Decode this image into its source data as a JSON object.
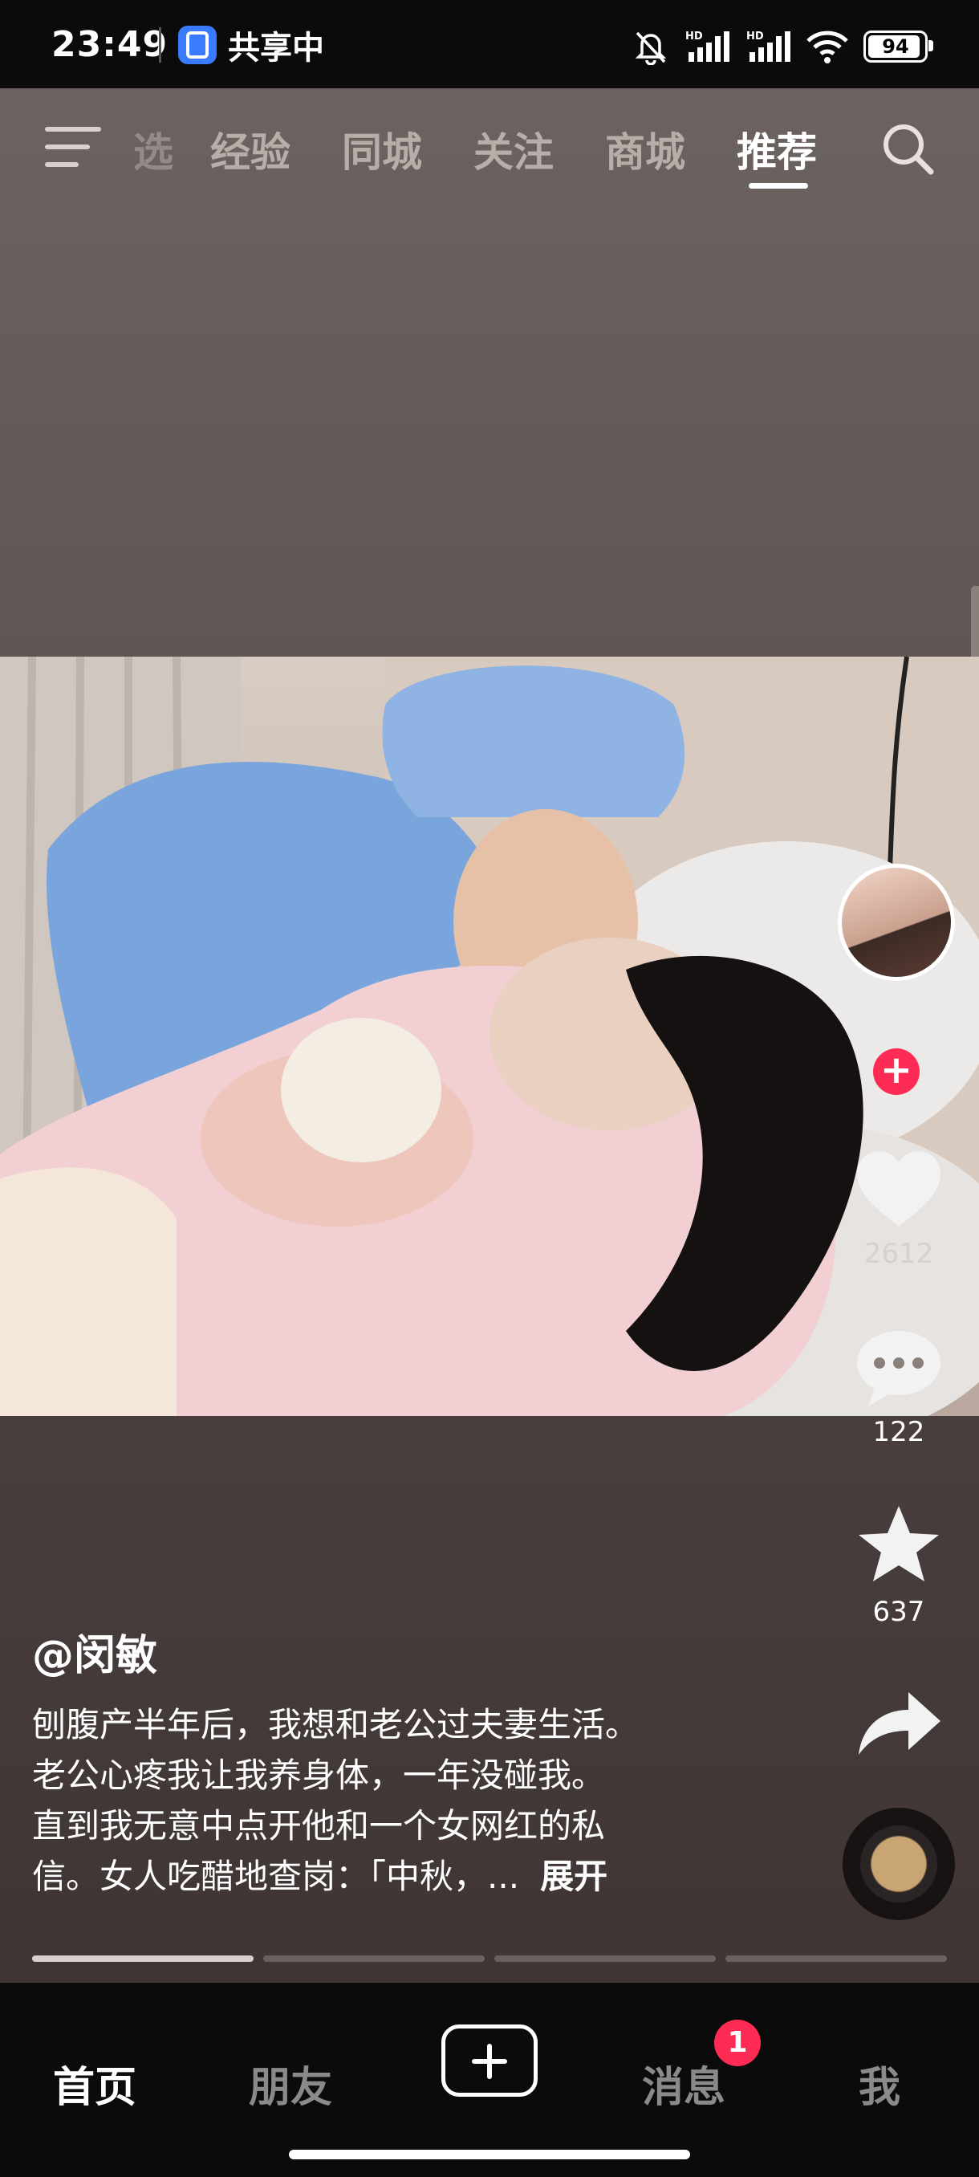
{
  "status_bar": {
    "time": "23:49",
    "share_label": "共享中",
    "battery": "94"
  },
  "top_nav": {
    "tabs": [
      {
        "label": "选"
      },
      {
        "label": "经验"
      },
      {
        "label": "同城"
      },
      {
        "label": "关注"
      },
      {
        "label": "商城"
      },
      {
        "label": "推荐"
      }
    ],
    "active_tab": "推荐"
  },
  "post": {
    "author": "@闵敏",
    "desc_lines": [
      "刨腹产半年后，我想和老公过夫妻生活。",
      "老公心疼我让我养身体，一年没碰我。",
      "直到我无意中点开他和一个女网红的私",
      "信。女人吃醋地查岗：「中秋，..."
    ],
    "expand_label": "展开",
    "likes": "2612",
    "comments": "122",
    "favorites": "637"
  },
  "bottom_nav": {
    "items": [
      {
        "label": "首页"
      },
      {
        "label": "朋友"
      },
      {
        "label": "消息"
      },
      {
        "label": "我"
      }
    ],
    "messages_badge": "1"
  },
  "colors": {
    "accent": "#fe2c55",
    "background": "#0b0b0b"
  }
}
